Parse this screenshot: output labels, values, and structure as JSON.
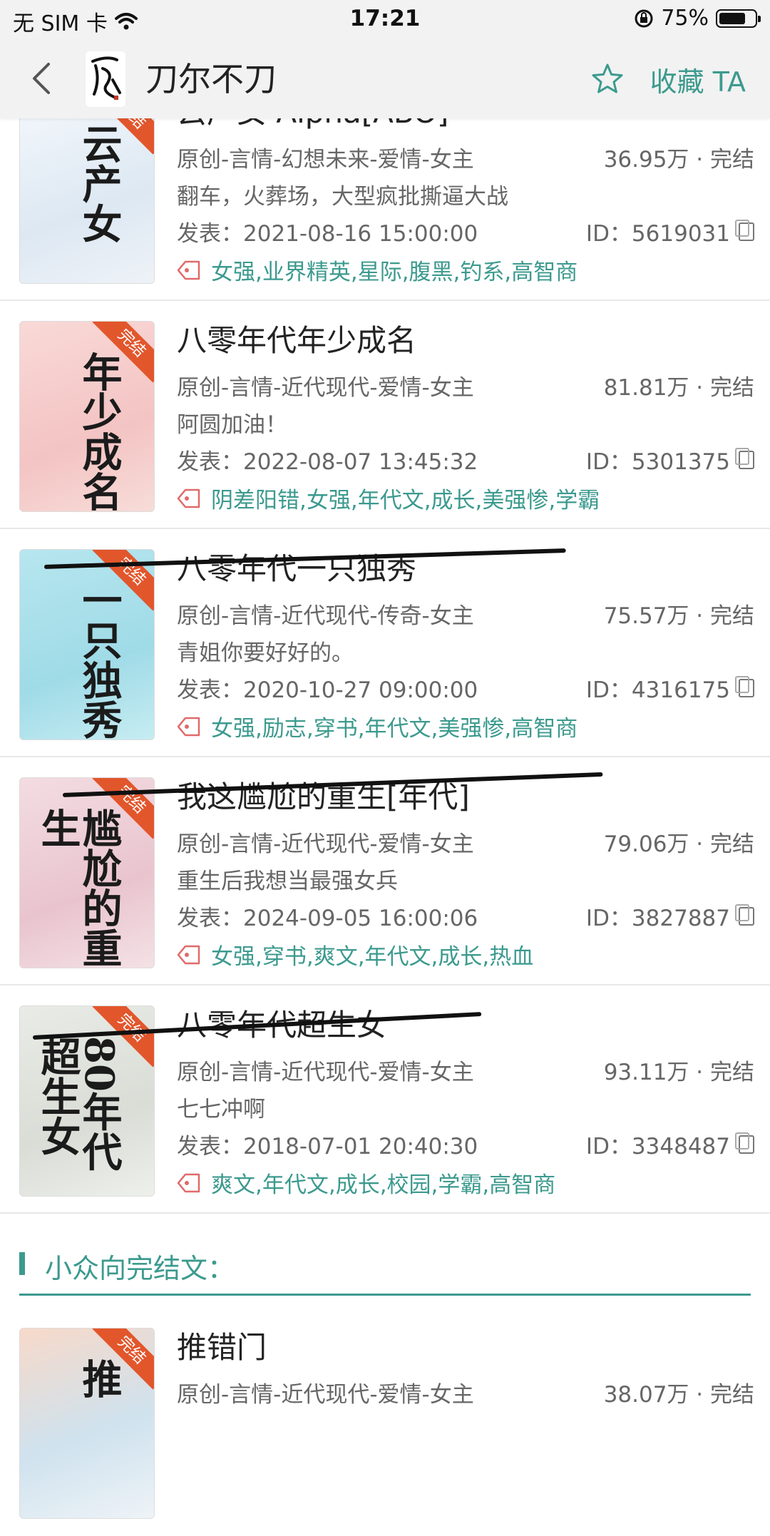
{
  "status_bar": {
    "carrier": "无 SIM 卡",
    "time": "17:21",
    "battery": "75%",
    "battery_level": 0.75
  },
  "nav": {
    "author": "刀尔不刀",
    "favorite": "收藏 TA"
  },
  "books": [
    {
      "title": "云产女 Alpha[ABO]",
      "category": "原创-言情-幻想未来-爱情-女主",
      "count": "36.95万 · 完结",
      "desc": "翻车，火葬场，大型疯批撕逼大战",
      "date": "发表：2021-08-16 15:00:00",
      "id": "ID：5619031",
      "tags": "女强,业界精英,星际,腹黑,钓系,高智商",
      "cover_text": "云产女",
      "badge": "完结",
      "struck": false
    },
    {
      "title": "八零年代年少成名",
      "category": "原创-言情-近代现代-爱情-女主",
      "count": "81.81万 · 完结",
      "desc": "阿圆加油！",
      "date": "发表：2022-08-07 13:45:32",
      "id": "ID：5301375",
      "tags": "阴差阳错,女强,年代文,成长,美强惨,学霸",
      "cover_text": "年少成名",
      "badge": "完结",
      "struck": false
    },
    {
      "title": "八零年代一只独秀",
      "category": "原创-言情-近代现代-传奇-女主",
      "count": "75.57万 · 完结",
      "desc": "青姐你要好好的。",
      "date": "发表：2020-10-27 09:00:00",
      "id": "ID：4316175",
      "tags": "女强,励志,穿书,年代文,美强惨,高智商",
      "cover_text": "一只独秀",
      "badge": "完结",
      "struck": true
    },
    {
      "title": "我这尴尬的重生[年代]",
      "category": "原创-言情-近代现代-爱情-女主",
      "count": "79.06万 · 完结",
      "desc": "重生后我想当最强女兵",
      "date": "发表：2024-09-05 16:00:06",
      "id": "ID：3827887",
      "tags": "女强,穿书,爽文,年代文,成长,热血",
      "cover_text": "尴尬的重生",
      "badge": "完结",
      "struck": true
    },
    {
      "title": "八零年代超生女",
      "category": "原创-言情-近代现代-爱情-女主",
      "count": "93.11万 · 完结",
      "desc": "七七冲啊",
      "date": "发表：2018-07-01 20:40:30",
      "id": "ID：3348487",
      "tags": "爽文,年代文,成长,校园,学霸,高智商",
      "cover_text": "80年代超生女",
      "badge": "完结",
      "struck": true
    },
    {
      "title": "推错门",
      "category": "原创-言情-近代现代-爱情-女主",
      "count": "38.07万 · 完结",
      "desc": "",
      "date": "",
      "id": "",
      "tags": "",
      "cover_text": "推",
      "badge": "完结",
      "struck": false
    }
  ],
  "section": {
    "title": "小众向完结文："
  },
  "colors": {
    "accent": "#3c9a8e",
    "badge": "#e2562c",
    "background": "#ffffff",
    "bar": "#f2f2f2"
  }
}
